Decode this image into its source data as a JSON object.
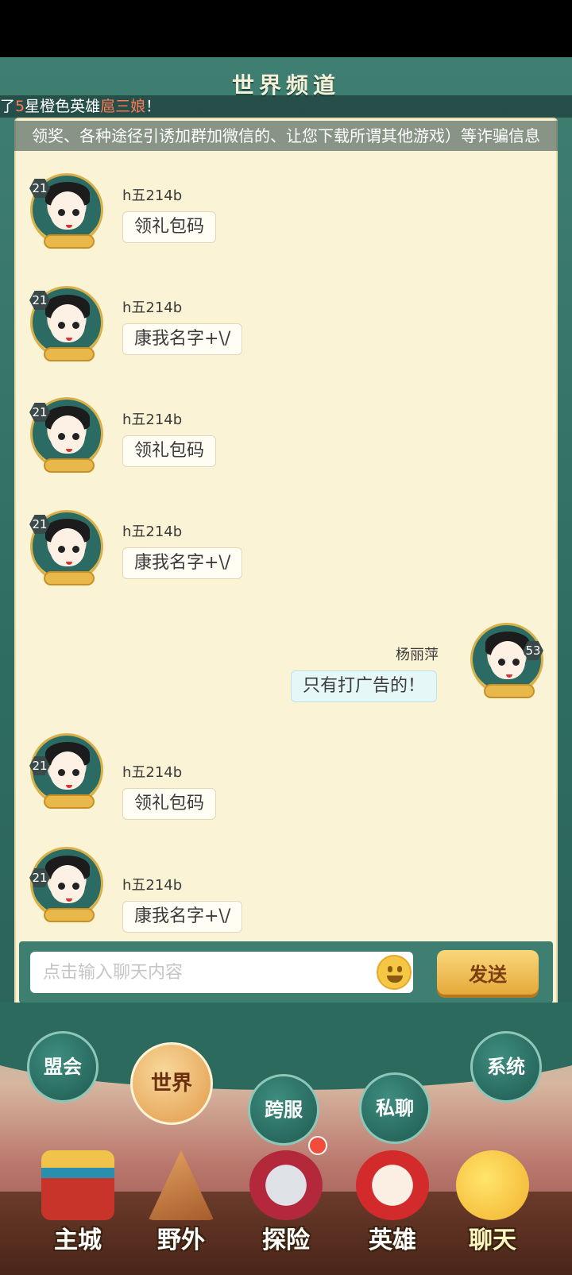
{
  "header": {
    "title": "世界频道",
    "ticker_prefix": "了",
    "ticker_star": "5",
    "ticker_mid": "星橙色英雄",
    "ticker_hero": "扈三娘",
    "ticker_suffix": "！",
    "notice": "领奖、各种途径引诱加群加微信的、让您下载所谓其他游戏）等诈骗信息"
  },
  "messages": [
    {
      "user": "h五214b",
      "level": "21",
      "text": "领礼包码",
      "self": false
    },
    {
      "user": "h五214b",
      "level": "21",
      "text": "康我名字+\\/",
      "self": false
    },
    {
      "user": "h五214b",
      "level": "21",
      "text": "领礼包码",
      "self": false
    },
    {
      "user": "h五214b",
      "level": "21",
      "text": "康我名字+\\/",
      "self": false
    },
    {
      "user": "杨丽萍",
      "level": "53",
      "text": "只有打广告的！",
      "self": true
    },
    {
      "user": "h五214b",
      "level": "21",
      "text": "领礼包码",
      "self": false
    },
    {
      "user": "h五214b",
      "level": "21",
      "text": "康我名字+\\/",
      "self": false
    }
  ],
  "input": {
    "placeholder": "点击输入聊天内容",
    "emoji_icon": "smiley-icon",
    "send_label": "发送"
  },
  "channels": [
    {
      "label": "盟会",
      "active": false
    },
    {
      "label": "世界",
      "active": true
    },
    {
      "label": "跨服",
      "active": false
    },
    {
      "label": "私聊",
      "active": false
    },
    {
      "label": "系统",
      "active": false
    }
  ],
  "nav": [
    {
      "label": "主城",
      "icon": "palace-icon"
    },
    {
      "label": "野外",
      "icon": "mountain-icon"
    },
    {
      "label": "探险",
      "icon": "crossed-swords-icon",
      "badge": true
    },
    {
      "label": "英雄",
      "icon": "opera-mask-icon"
    },
    {
      "label": "聊天",
      "icon": "chat-faces-icon",
      "active": true
    }
  ],
  "colors": {
    "frame": "#3f7f72",
    "parchment": "#fbf3d6",
    "highlight": "#ff7a55",
    "send": "#f2c25a",
    "active_tab": "#e29a4a"
  }
}
